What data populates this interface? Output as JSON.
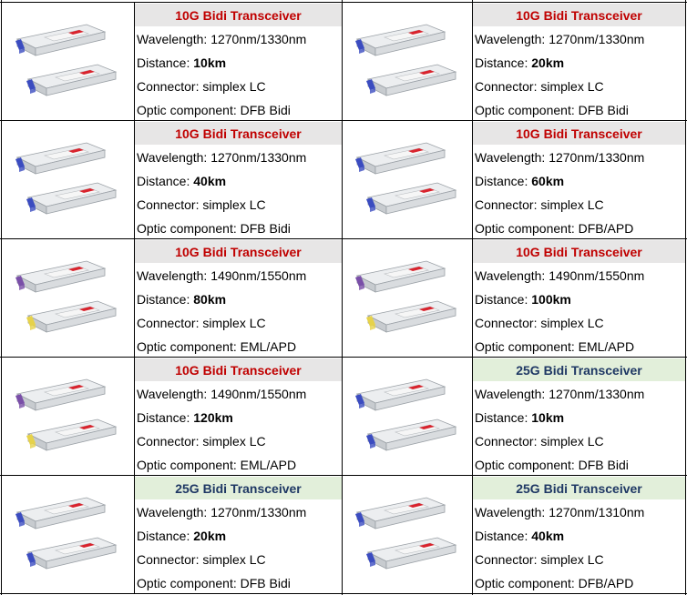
{
  "labels": {
    "wavelength": "Wavelength: ",
    "distance": "Distance: ",
    "connector": "Connector: ",
    "optic": "Optic component: "
  },
  "colors": {
    "title_10g_bg": "#e7e6e6",
    "title_10g_text": "#c00000",
    "title_25g_bg": "#e2efda",
    "title_25g_text": "#1f3864",
    "grid_line": "#000000",
    "blue_tab": "#3b4cc0",
    "purple_tab": "#7a4fa8",
    "yellow_tab": "#e6d24a",
    "red_label": "#d9232d"
  },
  "products": [
    {
      "title": "10G Bidi Transceiver",
      "speed": "10G",
      "wavelength": "1270nm/1330nm",
      "distance": "10km",
      "connector": "simplex LC",
      "optic": "DFB Bidi",
      "tabs": [
        "blue",
        "blue"
      ]
    },
    {
      "title": "10G Bidi Transceiver",
      "speed": "10G",
      "wavelength": "1270nm/1330nm",
      "distance": "20km",
      "connector": "simplex LC",
      "optic": "DFB Bidi",
      "tabs": [
        "blue",
        "blue"
      ]
    },
    {
      "title": "10G Bidi Transceiver",
      "speed": "10G",
      "wavelength": "1270nm/1330nm",
      "distance": "40km",
      "connector": "simplex LC",
      "optic": "DFB Bidi",
      "tabs": [
        "blue",
        "blue"
      ]
    },
    {
      "title": "10G Bidi Transceiver",
      "speed": "10G",
      "wavelength": "1270nm/1330nm",
      "distance": "60km",
      "connector": "simplex LC",
      "optic": "DFB/APD",
      "tabs": [
        "blue",
        "blue"
      ]
    },
    {
      "title": "10G Bidi Transceiver",
      "speed": "10G",
      "wavelength": "1490nm/1550nm",
      "distance": "80km",
      "connector": "simplex LC",
      "optic": "EML/APD",
      "tabs": [
        "purple",
        "yellow"
      ]
    },
    {
      "title": "10G Bidi Transceiver",
      "speed": "10G",
      "wavelength": "1490nm/1550nm",
      "distance": "100km",
      "connector": "simplex LC",
      "optic": "EML/APD",
      "tabs": [
        "purple",
        "yellow"
      ]
    },
    {
      "title": "10G Bidi Transceiver",
      "speed": "10G",
      "wavelength": "1490nm/1550nm",
      "distance": "120km",
      "connector": "simplex LC",
      "optic": "EML/APD",
      "tabs": [
        "purple",
        "yellow"
      ]
    },
    {
      "title": "25G Bidi Transceiver",
      "speed": "25G",
      "wavelength": "1270nm/1330nm",
      "distance": "10km",
      "connector": "simplex LC",
      "optic": "DFB Bidi",
      "tabs": [
        "blue",
        "blue"
      ]
    },
    {
      "title": "25G Bidi Transceiver",
      "speed": "25G",
      "wavelength": "1270nm/1330nm",
      "distance": "20km",
      "connector": "simplex LC",
      "optic": "DFB Bidi",
      "tabs": [
        "blue",
        "blue"
      ]
    },
    {
      "title": "25G Bidi Transceiver",
      "speed": "25G",
      "wavelength": "1270nm/1310nm",
      "distance": "40km",
      "connector": "simplex LC",
      "optic": "DFB/APD",
      "tabs": [
        "blue",
        "blue"
      ]
    }
  ]
}
